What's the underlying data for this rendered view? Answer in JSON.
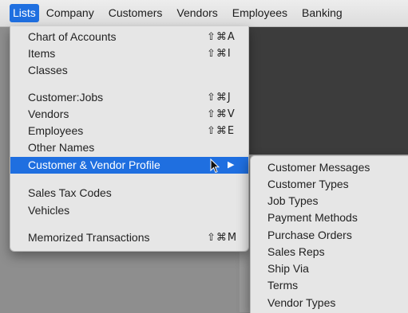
{
  "menubar": {
    "items": [
      {
        "label": "Lists",
        "active": true
      },
      {
        "label": "Company"
      },
      {
        "label": "Customers"
      },
      {
        "label": "Vendors"
      },
      {
        "label": "Employees"
      },
      {
        "label": "Banking"
      }
    ]
  },
  "lists_menu": {
    "items": [
      {
        "label": "Chart of Accounts",
        "shortcut": "⇧⌘A"
      },
      {
        "label": "Items",
        "shortcut": "⇧⌘I"
      },
      {
        "label": "Classes",
        "shortcut": ""
      },
      {
        "label": "Customer:Jobs",
        "shortcut": "⇧⌘J"
      },
      {
        "label": "Vendors",
        "shortcut": "⇧⌘V"
      },
      {
        "label": "Employees",
        "shortcut": "⇧⌘E"
      },
      {
        "label": "Other Names",
        "shortcut": ""
      },
      {
        "label": "Customer & Vendor Profile",
        "shortcut": "",
        "submenu": true,
        "highlighted": true
      },
      {
        "label": "Sales Tax Codes",
        "shortcut": ""
      },
      {
        "label": "Vehicles",
        "shortcut": ""
      },
      {
        "label": "Memorized Transactions",
        "shortcut": "⇧⌘M"
      }
    ]
  },
  "profile_submenu": {
    "items": [
      {
        "label": "Customer Messages"
      },
      {
        "label": "Customer Types"
      },
      {
        "label": "Job Types"
      },
      {
        "label": "Payment Methods"
      },
      {
        "label": "Purchase Orders"
      },
      {
        "label": "Sales Reps"
      },
      {
        "label": "Ship Via"
      },
      {
        "label": "Terms"
      },
      {
        "label": "Vendor Types"
      }
    ]
  },
  "icons": {
    "submenu_arrow": "triangle-right-icon",
    "cursor": "mouse-pointer-icon"
  },
  "colors": {
    "highlight": "#1f6fe0",
    "menu_bg": "#e6e6e6"
  }
}
